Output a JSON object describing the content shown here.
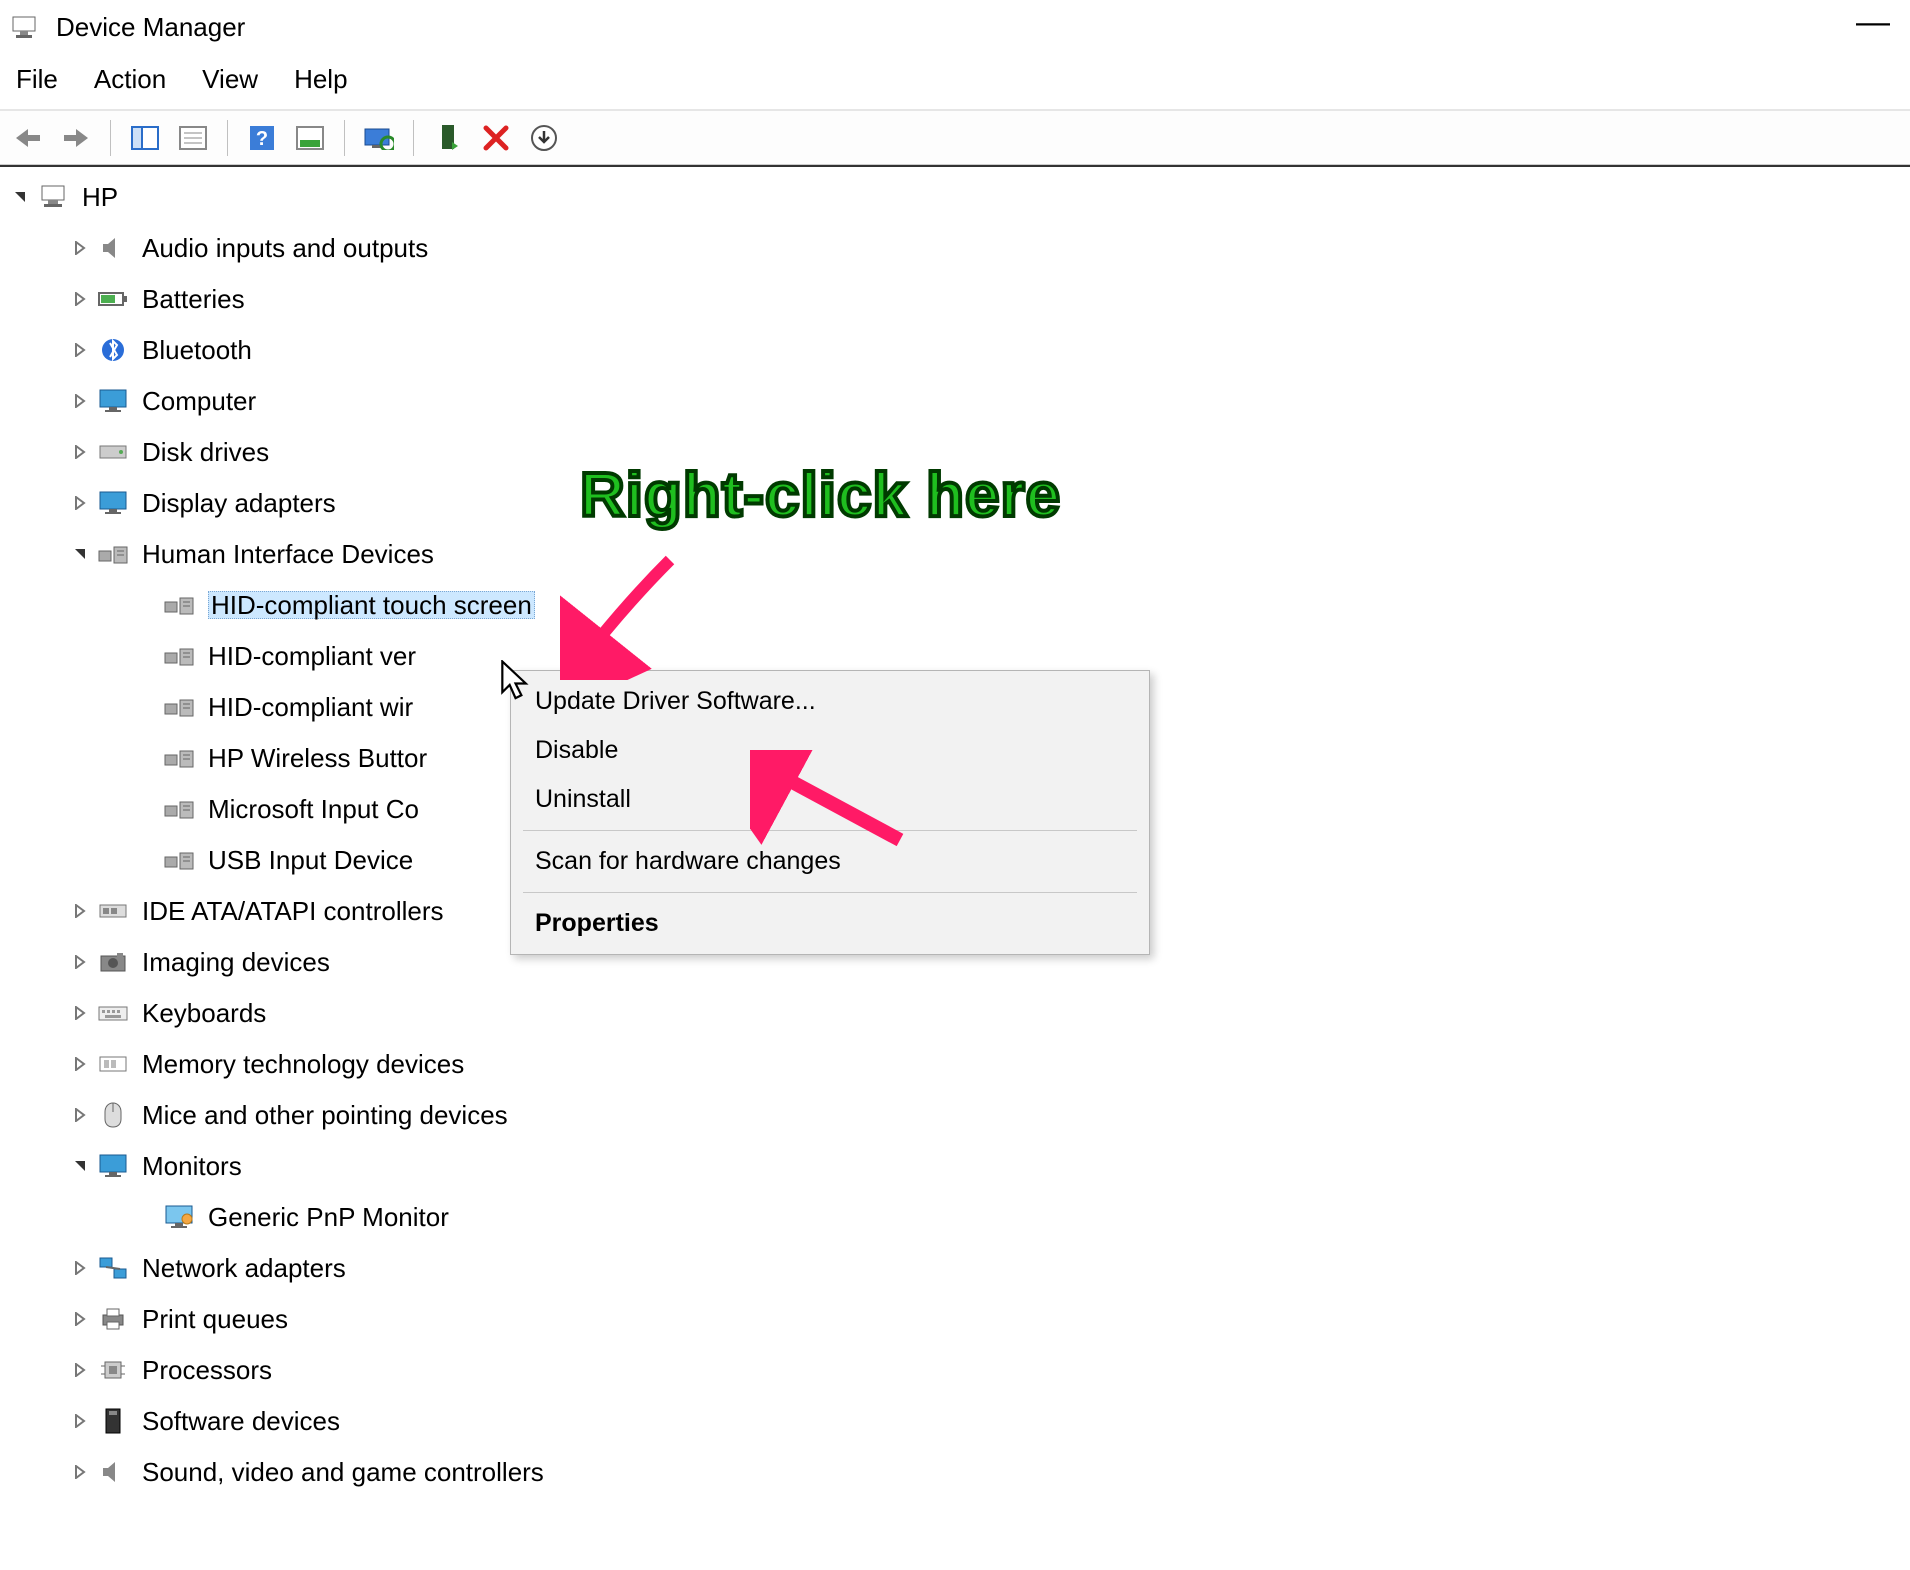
{
  "window": {
    "title": "Device Manager"
  },
  "menu": {
    "file": "File",
    "action": "Action",
    "view": "View",
    "help": "Help"
  },
  "tree": {
    "root": "HP",
    "categories": [
      {
        "label": "Audio inputs and outputs",
        "expanded": false
      },
      {
        "label": "Batteries",
        "expanded": false
      },
      {
        "label": "Bluetooth",
        "expanded": false
      },
      {
        "label": "Computer",
        "expanded": false
      },
      {
        "label": "Disk drives",
        "expanded": false
      },
      {
        "label": "Display adapters",
        "expanded": false
      },
      {
        "label": "Human Interface Devices",
        "expanded": true
      },
      {
        "label": "IDE ATA/ATAPI controllers",
        "expanded": false
      },
      {
        "label": "Imaging devices",
        "expanded": false
      },
      {
        "label": "Keyboards",
        "expanded": false
      },
      {
        "label": "Memory technology devices",
        "expanded": false
      },
      {
        "label": "Mice and other pointing devices",
        "expanded": false
      },
      {
        "label": "Monitors",
        "expanded": true
      },
      {
        "label": "Network adapters",
        "expanded": false
      },
      {
        "label": "Print queues",
        "expanded": false
      },
      {
        "label": "Processors",
        "expanded": false
      },
      {
        "label": "Software devices",
        "expanded": false
      },
      {
        "label": "Sound, video and game controllers",
        "expanded": false
      }
    ],
    "hid_children": [
      {
        "label": "HID-compliant touch screen",
        "selected": true
      },
      {
        "label": "HID-compliant ver"
      },
      {
        "label": "HID-compliant wir"
      },
      {
        "label": "HP Wireless Buttor"
      },
      {
        "label": "Microsoft Input Co"
      },
      {
        "label": "USB Input Device"
      }
    ],
    "monitor_children": [
      {
        "label": "Generic PnP Monitor"
      }
    ]
  },
  "context_menu": {
    "items": [
      {
        "label": "Update Driver Software...",
        "bold": false
      },
      {
        "label": "Disable",
        "bold": false
      },
      {
        "label": "Uninstall",
        "bold": false
      },
      {
        "sep": true
      },
      {
        "label": "Scan for hardware changes",
        "bold": false
      },
      {
        "sep": true
      },
      {
        "label": "Properties",
        "bold": true
      }
    ]
  },
  "annotation": {
    "text": "Right-click here"
  },
  "icons": {
    "computer": "computer-icon",
    "hid": "hid-icon"
  }
}
